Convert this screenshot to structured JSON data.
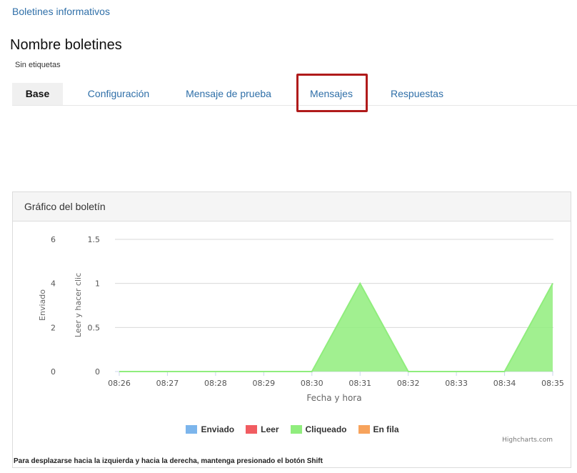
{
  "breadcrumb": "Boletines informativos",
  "page": {
    "title": "Nombre boletines",
    "tags": "Sin etiquetas"
  },
  "tabs": [
    {
      "label": "Base",
      "active": true
    },
    {
      "label": "Configuración",
      "active": false
    },
    {
      "label": "Mensaje de prueba",
      "active": false
    },
    {
      "label": "Mensajes",
      "active": false,
      "highlighted": true
    },
    {
      "label": "Respuestas",
      "active": false
    }
  ],
  "panel": {
    "title": "Gráfico del boletín",
    "credits": "Highcharts.com",
    "footer_note": "Para desplazarse hacia la izquierda y hacia la derecha, mantenga presionado el botón Shift"
  },
  "colors": {
    "link": "#2f6fa8",
    "highlight": "#b01b1b",
    "enviado": "#7cb5ec",
    "leer": "#f15c61",
    "cliqueado": "#90ed7d",
    "en_fila": "#f7a35c"
  },
  "chart_data": {
    "type": "area",
    "x": [
      "08:26",
      "08:27",
      "08:28",
      "08:29",
      "08:30",
      "08:31",
      "08:32",
      "08:33",
      "08:34",
      "08:35"
    ],
    "xlabel": "Fecha y hora",
    "y_axes": [
      {
        "label": "Enviado",
        "ticks": [
          "0",
          "2",
          "4",
          "6"
        ],
        "range": [
          0,
          6
        ]
      },
      {
        "label": "Leer y hacer clic",
        "ticks": [
          "0",
          "0.5",
          "1",
          "1.5"
        ],
        "range": [
          0,
          1.5
        ]
      }
    ],
    "grid": true,
    "legend_position": "bottom",
    "series": [
      {
        "name": "Enviado",
        "color": "#7cb5ec",
        "values": [
          0,
          0,
          0,
          0,
          0,
          0,
          0,
          0,
          0,
          0
        ]
      },
      {
        "name": "Leer",
        "color": "#f15c61",
        "values": [
          0,
          0,
          0,
          0,
          0,
          0,
          0,
          0,
          0,
          0
        ]
      },
      {
        "name": "Cliqueado",
        "color": "#90ed7d",
        "values": [
          0,
          0,
          0,
          0,
          0,
          1,
          0,
          0,
          0,
          1
        ]
      },
      {
        "name": "En fila",
        "color": "#f7a35c",
        "values": [
          0,
          0,
          0,
          0,
          0,
          0,
          0,
          0,
          0,
          0
        ]
      }
    ]
  }
}
